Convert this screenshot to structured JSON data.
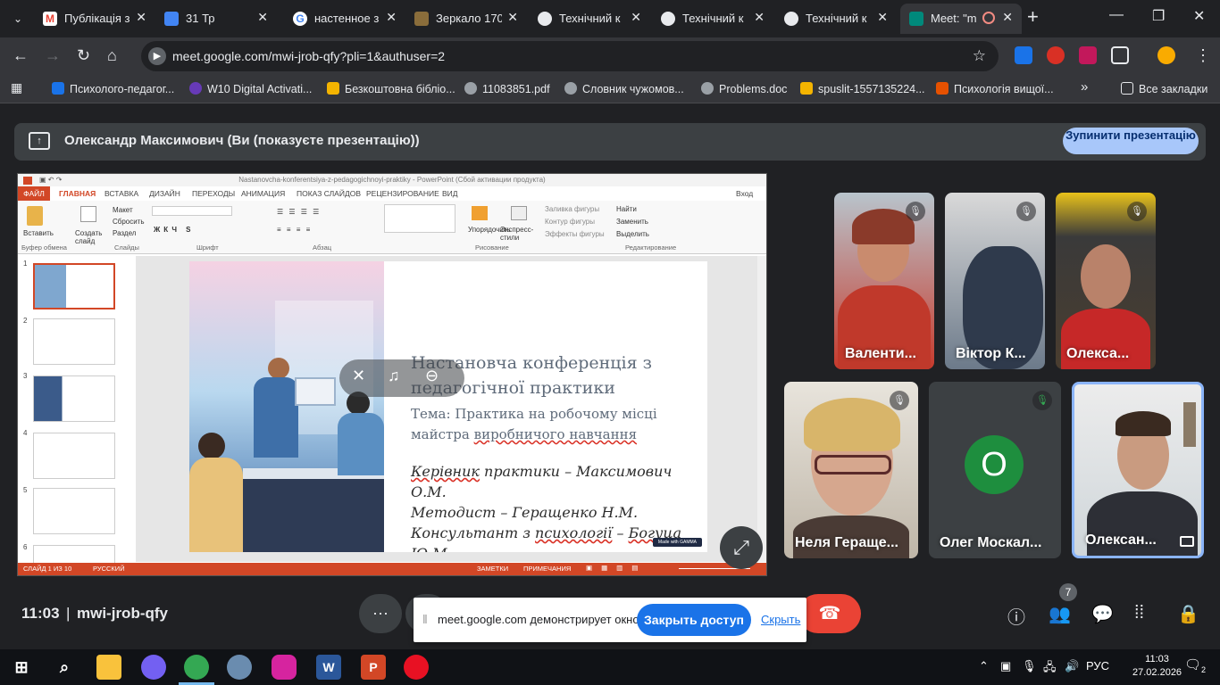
{
  "browser": {
    "tabs": [
      {
        "title": "Публікація з",
        "color": "#ea4335"
      },
      {
        "title": "31 Тр",
        "color": "#4285f4"
      },
      {
        "title": "настенное з",
        "color": "#4285f4"
      },
      {
        "title": "Зеркало 170",
        "color": "#8a6d3b"
      },
      {
        "title": "Технічний к",
        "color": "#e8eaed"
      },
      {
        "title": "Технічний к",
        "color": "#e8eaed"
      },
      {
        "title": "Технічний к",
        "color": "#e8eaed"
      },
      {
        "title": "Meet: \"m",
        "color": "#00897b"
      }
    ],
    "url": "meet.google.com/mwi-jrob-qfy?pli=1&authuser=2",
    "bookmarks": [
      {
        "label": "Психолого-педагог...",
        "color": "#1a73e8"
      },
      {
        "label": "W10 Digital Activati...",
        "color": "#673ab7"
      },
      {
        "label": "Безкоштовна бібліо...",
        "color": "#f4b400"
      },
      {
        "label": "11083851.pdf",
        "color": "#9aa0a6"
      },
      {
        "label": "Словник чужомов...",
        "color": "#9aa0a6"
      },
      {
        "label": "Problems.doc",
        "color": "#9aa0a6"
      },
      {
        "label": "spuslit-1557135224...",
        "color": "#f4b400"
      },
      {
        "label": "Психологія вищої...",
        "color": "#e65100"
      }
    ],
    "all_bookmarks": "Все закладки",
    "more_bookmarks": "»"
  },
  "banner": {
    "text": "Олександр Максимович (Ви (показуєте презентацію))",
    "stop_label": "Зупинити презентацію"
  },
  "powerpoint": {
    "window_title": "Nastanovcha-konferentsiya-z-pedagogichnoyi-praktiky - PowerPoint (Сбой активации продукта)",
    "file_tab": "ФАЙЛ",
    "tabs": [
      "ГЛАВНАЯ",
      "ВСТАВКА",
      "ДИЗАЙН",
      "ПЕРЕХОДЫ",
      "АНИМАЦИЯ",
      "ПОКАЗ СЛАЙДОВ",
      "РЕЦЕНЗИРОВАНИЕ",
      "ВИД"
    ],
    "login": "Вход",
    "ribbon": {
      "paste": "Вставить",
      "new_slide": "Создать слайд",
      "layout": "Макет",
      "reset": "Сбросить",
      "section": "Раздел",
      "arrange": "Упорядочить",
      "quick_styles": "Экспресс-стили",
      "shape_fill": "Заливка фигуры",
      "shape_outline": "Контур фигуры",
      "shape_effects": "Эффекты фигуры",
      "find": "Найти",
      "replace": "Заменить",
      "select": "Выделить",
      "groups": [
        "Буфер обмена",
        "Слайды",
        "Шрифт",
        "Абзац",
        "Рисование",
        "Редактирование"
      ]
    },
    "thumb_numbers": [
      "1",
      "2",
      "3",
      "4",
      "5",
      "6"
    ],
    "slide": {
      "title": "Настановча конференція з педагогічної практики",
      "subtitle_prefix": "Тема: Практика на робочому місці майстра ",
      "subtitle_underlined": "виробничого навчання",
      "line1_underlined": "Керівник",
      "line1_rest": " практики – Максимович О.М.",
      "line2": "Методист – Геращенко Н.М.",
      "line3_prefix": "Консультант з ",
      "line3_underlined": "психології",
      "line3_mid": " – ",
      "line3_underlined2": "Богуца",
      "line3_end": " Ю.М.",
      "made_with": "Made with GAMMA"
    },
    "status": {
      "slide_of": "СЛАЙД 1 ИЗ 10",
      "language": "РУССКИЙ",
      "notes": "ЗАМЕТКИ",
      "comments": "ПРИМЕЧАНИЯ"
    }
  },
  "participants": [
    {
      "name": "Валенти...",
      "muted": true
    },
    {
      "name": "Віктор К...",
      "muted": true
    },
    {
      "name": "Олекса...",
      "muted": true
    },
    {
      "name": "Неля Геращe...",
      "muted": true
    },
    {
      "name": "Олег Москал...",
      "muted": true,
      "initial": "О"
    },
    {
      "name": "Олексан...",
      "muted": false
    }
  ],
  "bottom": {
    "time": "11:03",
    "meeting_code": "mwi-jrob-qfy",
    "people_count": "7"
  },
  "share_notice": {
    "text": "meet.google.com демонстрирует окно.",
    "close_label": "Закрыть доступ",
    "hide_label": "Скрыть"
  },
  "taskbar": {
    "language": "РУС",
    "time": "11:03",
    "date": "27.02.2026",
    "notifications": "2"
  }
}
